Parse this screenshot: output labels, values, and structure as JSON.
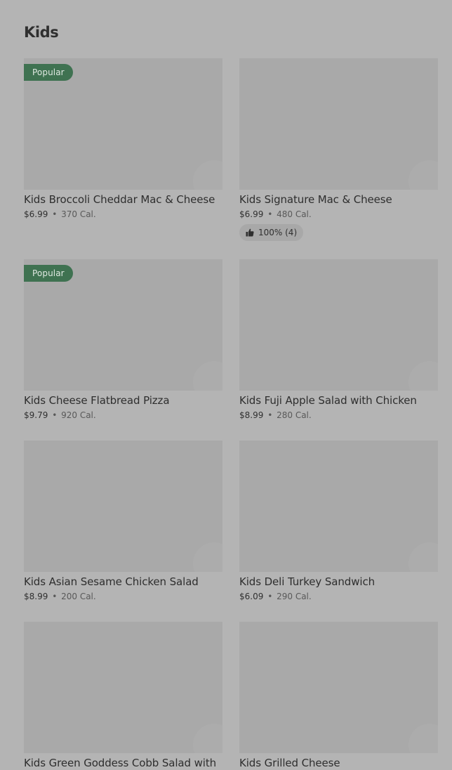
{
  "section": {
    "title": "Kids"
  },
  "items": [
    {
      "name": "Kids Broccoli Cheddar Mac & Cheese",
      "price": "$6.99",
      "separator": "•",
      "calories": "370 Cal.",
      "badge": "Popular"
    },
    {
      "name": "Kids Signature Mac & Cheese",
      "price": "$6.99",
      "separator": "•",
      "calories": "480 Cal.",
      "rating": "100% (4)",
      "rating_icon": "thumbs-up-icon"
    },
    {
      "name": "Kids Cheese Flatbread Pizza",
      "price": "$9.79",
      "separator": "•",
      "calories": "920 Cal.",
      "badge": "Popular"
    },
    {
      "name": "Kids Fuji Apple Salad with Chicken",
      "price": "$8.99",
      "separator": "•",
      "calories": "280 Cal."
    },
    {
      "name": "Kids Asian Sesame Chicken Salad",
      "price": "$8.99",
      "separator": "•",
      "calories": "200 Cal."
    },
    {
      "name": "Kids Deli Turkey Sandwich",
      "price": "$6.09",
      "separator": "•",
      "calories": "290 Cal."
    },
    {
      "name": "Kids Green Goddess Cobb Salad with",
      "price": "",
      "separator": "",
      "calories": ""
    },
    {
      "name": "Kids Grilled Cheese",
      "price": "",
      "separator": "",
      "calories": ""
    }
  ],
  "colors": {
    "overlay_background": "#b4b4b4",
    "image_placeholder": "#a9a9a9",
    "popular_badge": "#3f7251"
  }
}
